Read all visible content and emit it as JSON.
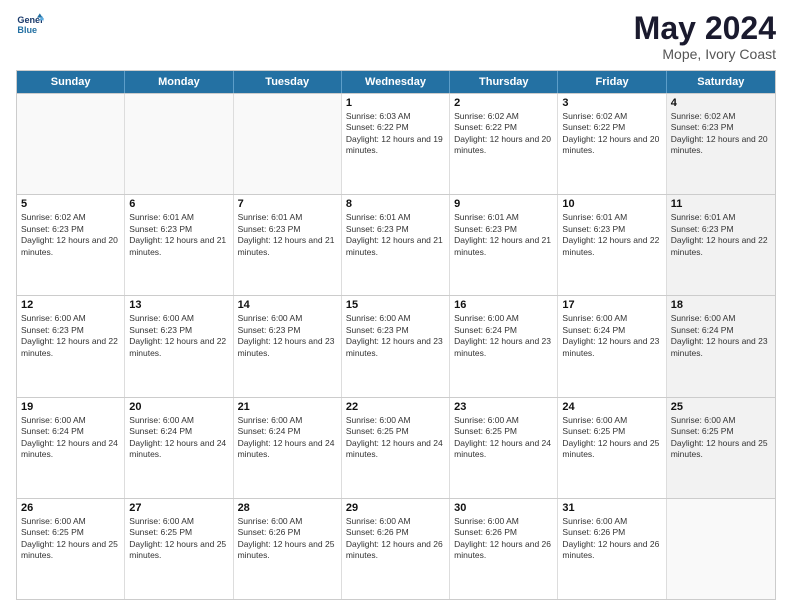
{
  "header": {
    "logo_line1": "General",
    "logo_line2": "Blue",
    "month_title": "May 2024",
    "location": "Mope, Ivory Coast"
  },
  "days_of_week": [
    "Sunday",
    "Monday",
    "Tuesday",
    "Wednesday",
    "Thursday",
    "Friday",
    "Saturday"
  ],
  "rows": [
    [
      {
        "day": "",
        "text": "",
        "empty": true
      },
      {
        "day": "",
        "text": "",
        "empty": true
      },
      {
        "day": "",
        "text": "",
        "empty": true
      },
      {
        "day": "1",
        "text": "Sunrise: 6:03 AM\nSunset: 6:22 PM\nDaylight: 12 hours and 19 minutes."
      },
      {
        "day": "2",
        "text": "Sunrise: 6:02 AM\nSunset: 6:22 PM\nDaylight: 12 hours and 20 minutes."
      },
      {
        "day": "3",
        "text": "Sunrise: 6:02 AM\nSunset: 6:22 PM\nDaylight: 12 hours and 20 minutes."
      },
      {
        "day": "4",
        "text": "Sunrise: 6:02 AM\nSunset: 6:23 PM\nDaylight: 12 hours and 20 minutes.",
        "shaded": true
      }
    ],
    [
      {
        "day": "5",
        "text": "Sunrise: 6:02 AM\nSunset: 6:23 PM\nDaylight: 12 hours and 20 minutes."
      },
      {
        "day": "6",
        "text": "Sunrise: 6:01 AM\nSunset: 6:23 PM\nDaylight: 12 hours and 21 minutes."
      },
      {
        "day": "7",
        "text": "Sunrise: 6:01 AM\nSunset: 6:23 PM\nDaylight: 12 hours and 21 minutes."
      },
      {
        "day": "8",
        "text": "Sunrise: 6:01 AM\nSunset: 6:23 PM\nDaylight: 12 hours and 21 minutes."
      },
      {
        "day": "9",
        "text": "Sunrise: 6:01 AM\nSunset: 6:23 PM\nDaylight: 12 hours and 21 minutes."
      },
      {
        "day": "10",
        "text": "Sunrise: 6:01 AM\nSunset: 6:23 PM\nDaylight: 12 hours and 22 minutes."
      },
      {
        "day": "11",
        "text": "Sunrise: 6:01 AM\nSunset: 6:23 PM\nDaylight: 12 hours and 22 minutes.",
        "shaded": true
      }
    ],
    [
      {
        "day": "12",
        "text": "Sunrise: 6:00 AM\nSunset: 6:23 PM\nDaylight: 12 hours and 22 minutes."
      },
      {
        "day": "13",
        "text": "Sunrise: 6:00 AM\nSunset: 6:23 PM\nDaylight: 12 hours and 22 minutes."
      },
      {
        "day": "14",
        "text": "Sunrise: 6:00 AM\nSunset: 6:23 PM\nDaylight: 12 hours and 23 minutes."
      },
      {
        "day": "15",
        "text": "Sunrise: 6:00 AM\nSunset: 6:23 PM\nDaylight: 12 hours and 23 minutes."
      },
      {
        "day": "16",
        "text": "Sunrise: 6:00 AM\nSunset: 6:24 PM\nDaylight: 12 hours and 23 minutes."
      },
      {
        "day": "17",
        "text": "Sunrise: 6:00 AM\nSunset: 6:24 PM\nDaylight: 12 hours and 23 minutes."
      },
      {
        "day": "18",
        "text": "Sunrise: 6:00 AM\nSunset: 6:24 PM\nDaylight: 12 hours and 23 minutes.",
        "shaded": true
      }
    ],
    [
      {
        "day": "19",
        "text": "Sunrise: 6:00 AM\nSunset: 6:24 PM\nDaylight: 12 hours and 24 minutes."
      },
      {
        "day": "20",
        "text": "Sunrise: 6:00 AM\nSunset: 6:24 PM\nDaylight: 12 hours and 24 minutes."
      },
      {
        "day": "21",
        "text": "Sunrise: 6:00 AM\nSunset: 6:24 PM\nDaylight: 12 hours and 24 minutes."
      },
      {
        "day": "22",
        "text": "Sunrise: 6:00 AM\nSunset: 6:25 PM\nDaylight: 12 hours and 24 minutes."
      },
      {
        "day": "23",
        "text": "Sunrise: 6:00 AM\nSunset: 6:25 PM\nDaylight: 12 hours and 24 minutes."
      },
      {
        "day": "24",
        "text": "Sunrise: 6:00 AM\nSunset: 6:25 PM\nDaylight: 12 hours and 25 minutes."
      },
      {
        "day": "25",
        "text": "Sunrise: 6:00 AM\nSunset: 6:25 PM\nDaylight: 12 hours and 25 minutes.",
        "shaded": true
      }
    ],
    [
      {
        "day": "26",
        "text": "Sunrise: 6:00 AM\nSunset: 6:25 PM\nDaylight: 12 hours and 25 minutes."
      },
      {
        "day": "27",
        "text": "Sunrise: 6:00 AM\nSunset: 6:25 PM\nDaylight: 12 hours and 25 minutes."
      },
      {
        "day": "28",
        "text": "Sunrise: 6:00 AM\nSunset: 6:26 PM\nDaylight: 12 hours and 25 minutes."
      },
      {
        "day": "29",
        "text": "Sunrise: 6:00 AM\nSunset: 6:26 PM\nDaylight: 12 hours and 26 minutes."
      },
      {
        "day": "30",
        "text": "Sunrise: 6:00 AM\nSunset: 6:26 PM\nDaylight: 12 hours and 26 minutes."
      },
      {
        "day": "31",
        "text": "Sunrise: 6:00 AM\nSunset: 6:26 PM\nDaylight: 12 hours and 26 minutes."
      },
      {
        "day": "",
        "text": "",
        "empty": true,
        "shaded": true
      }
    ]
  ]
}
